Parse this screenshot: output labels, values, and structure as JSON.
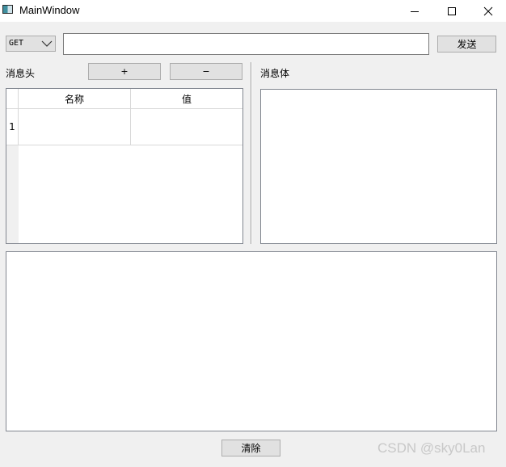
{
  "window": {
    "title": "MainWindow"
  },
  "icons": {
    "app": "app-window-icon",
    "minimize": "minimize-icon",
    "maximize": "maximize-icon",
    "close": "close-icon",
    "dropdown": "chevron-down-icon"
  },
  "request": {
    "method": "GET",
    "url_value": "",
    "send_label": "发送"
  },
  "headers": {
    "label": "消息头",
    "add_label": "+",
    "remove_label": "−",
    "columns": [
      "名称",
      "值"
    ],
    "rows": [
      {
        "index": "1",
        "name": "",
        "value": ""
      }
    ]
  },
  "body": {
    "label": "消息体",
    "value": ""
  },
  "response": {
    "value": ""
  },
  "footer": {
    "clear_label": "清除"
  },
  "watermark": "CSDN @sky0Lan"
}
